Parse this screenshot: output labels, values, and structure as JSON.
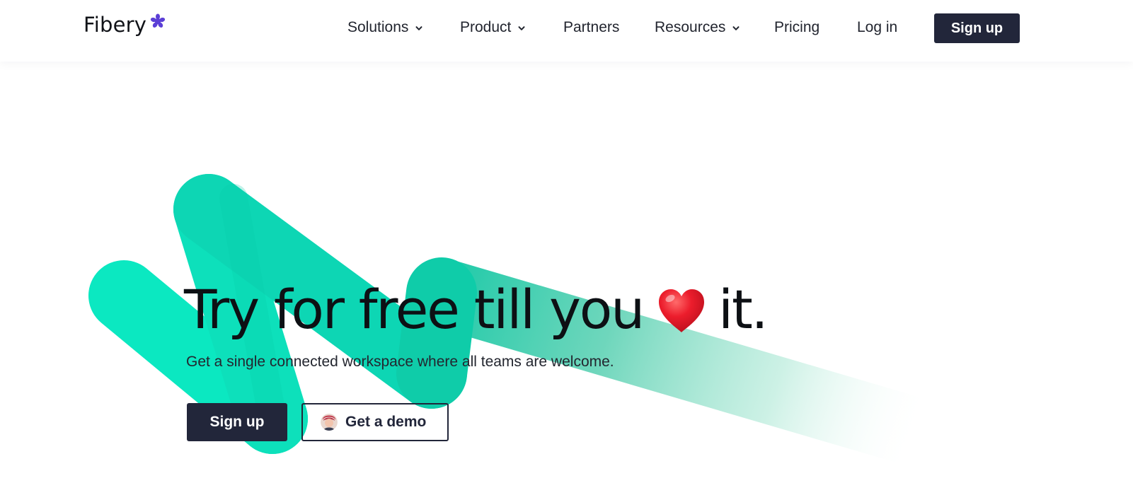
{
  "brand": {
    "name": "Fibery",
    "mark_color": "#5b3fd6"
  },
  "nav": {
    "items": [
      {
        "label": "Solutions",
        "has_dropdown": true
      },
      {
        "label": "Product",
        "has_dropdown": true
      },
      {
        "label": "Partners",
        "has_dropdown": false
      },
      {
        "label": "Resources",
        "has_dropdown": true
      },
      {
        "label": "Pricing",
        "has_dropdown": false
      },
      {
        "label": "Log in",
        "has_dropdown": false
      }
    ],
    "signup_label": "Sign up"
  },
  "hero": {
    "title_before": "Try for free till you",
    "title_icon": "heart-icon",
    "title_after": "it.",
    "subtitle": "Get a single connected workspace where all teams are welcome.",
    "primary_cta": "Sign up",
    "secondary_cta": "Get a demo",
    "secondary_cta_icon": "avatar"
  },
  "colors": {
    "accent_teal": "#0be3bd",
    "dark_button": "#22263a",
    "heart_red": "#e5172b"
  }
}
